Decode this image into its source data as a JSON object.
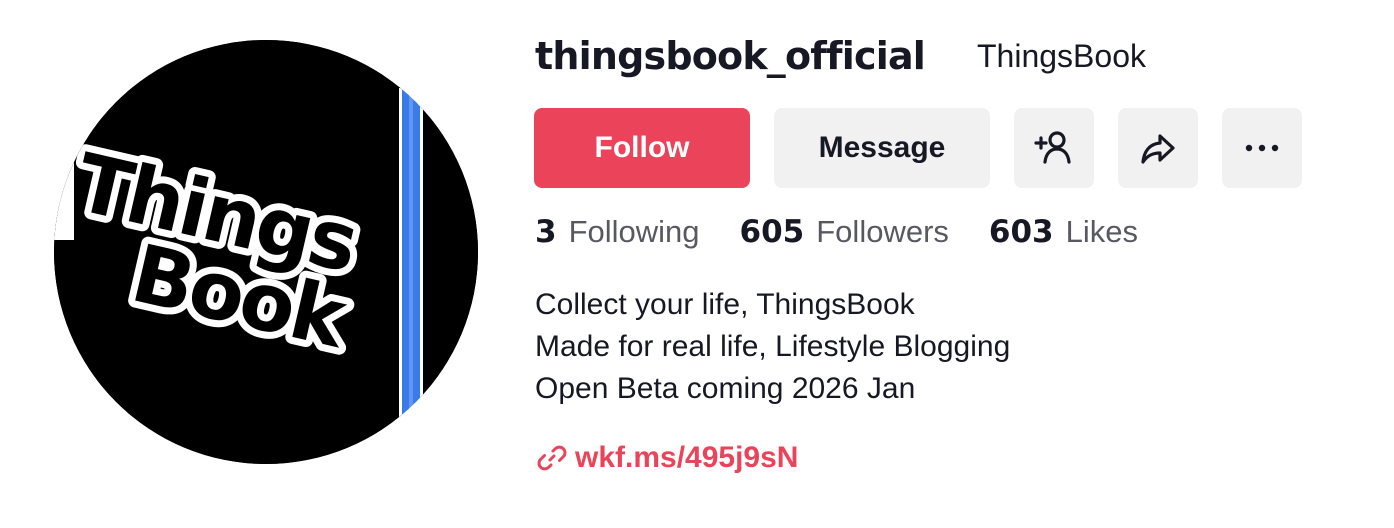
{
  "profile": {
    "username": "thingsbook_official",
    "display_name": "ThingsBook",
    "avatar": {
      "icon": "thingsbook-logo",
      "logo_lines": [
        "Things",
        "Book"
      ],
      "colors": {
        "background": "#000000",
        "text": "#000000",
        "outline": "#ffffff",
        "stripe": "#3b7be8"
      }
    }
  },
  "actions": {
    "follow_label": "Follow",
    "message_label": "Message",
    "add_friend_icon": "person-plus-icon",
    "share_icon": "share-arrow-icon",
    "more_icon": "ellipsis-icon"
  },
  "stats": [
    {
      "value": "3",
      "label": "Following"
    },
    {
      "value": "605",
      "label": "Followers"
    },
    {
      "value": "603",
      "label": "Likes"
    }
  ],
  "bio": {
    "lines": [
      "Collect your life, ThingsBook",
      "Made for real life, Lifestyle Blogging",
      "Open Beta coming 2026 Jan"
    ]
  },
  "link": {
    "icon": "link-icon",
    "text": "wkf.ms/495j9sN"
  },
  "colors": {
    "accent": "#eb445a",
    "button_gray": "#f1f1f2",
    "text_primary": "#161823"
  }
}
